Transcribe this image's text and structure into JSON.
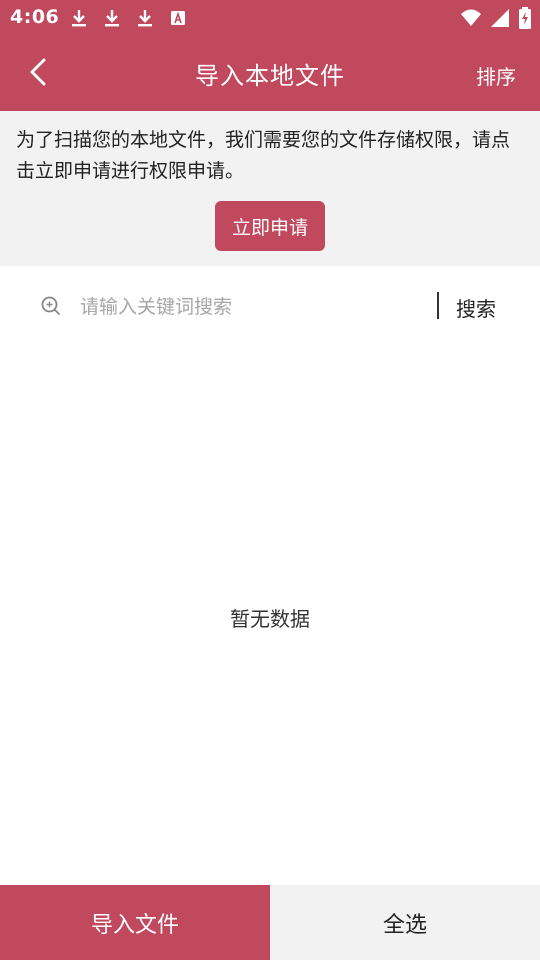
{
  "status_bar": {
    "time": "4:06",
    "left_icons": [
      "download-icon",
      "download-icon",
      "download-icon",
      "app-a-icon"
    ],
    "right_icons": [
      "wifi-icon",
      "signal-icon",
      "battery-charging-icon"
    ]
  },
  "app_bar": {
    "title": "导入本地文件",
    "sort_label": "排序",
    "back_icon": "chevron-left-icon"
  },
  "permission": {
    "message": "为了扫描您的本地文件，我们需要您的文件存储权限，请点击立即申请进行权限申请。",
    "button_label": "立即申请"
  },
  "search": {
    "placeholder": "请输入关键词搜索",
    "value": "",
    "button_label": "搜索",
    "icon": "search-icon"
  },
  "empty_state": {
    "message": "暂无数据"
  },
  "bottom_bar": {
    "import_label": "导入文件",
    "select_all_label": "全选"
  },
  "colors": {
    "primary": "#c0495d",
    "panel_bg": "#f2f2f2",
    "placeholder": "#a6a6a6"
  }
}
